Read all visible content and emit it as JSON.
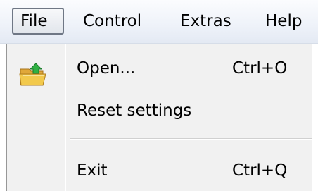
{
  "menubar": {
    "items": [
      {
        "label": "File",
        "active": true
      },
      {
        "label": "Control"
      },
      {
        "label": "Extras"
      },
      {
        "label": "Help"
      }
    ]
  },
  "file_menu": {
    "items": [
      {
        "label": "Open...",
        "shortcut": "Ctrl+O",
        "icon": "folder-open-icon"
      },
      {
        "label": "Reset settings",
        "shortcut": ""
      },
      {
        "label": "Exit",
        "shortcut": "Ctrl+Q"
      }
    ]
  },
  "colors": {
    "menubar_bg": "#eef2f9",
    "dropdown_bg": "#f1f1f1",
    "active_border": "#6f7785",
    "folder_yellow": "#f2c94c",
    "arrow_green": "#2fb043"
  }
}
